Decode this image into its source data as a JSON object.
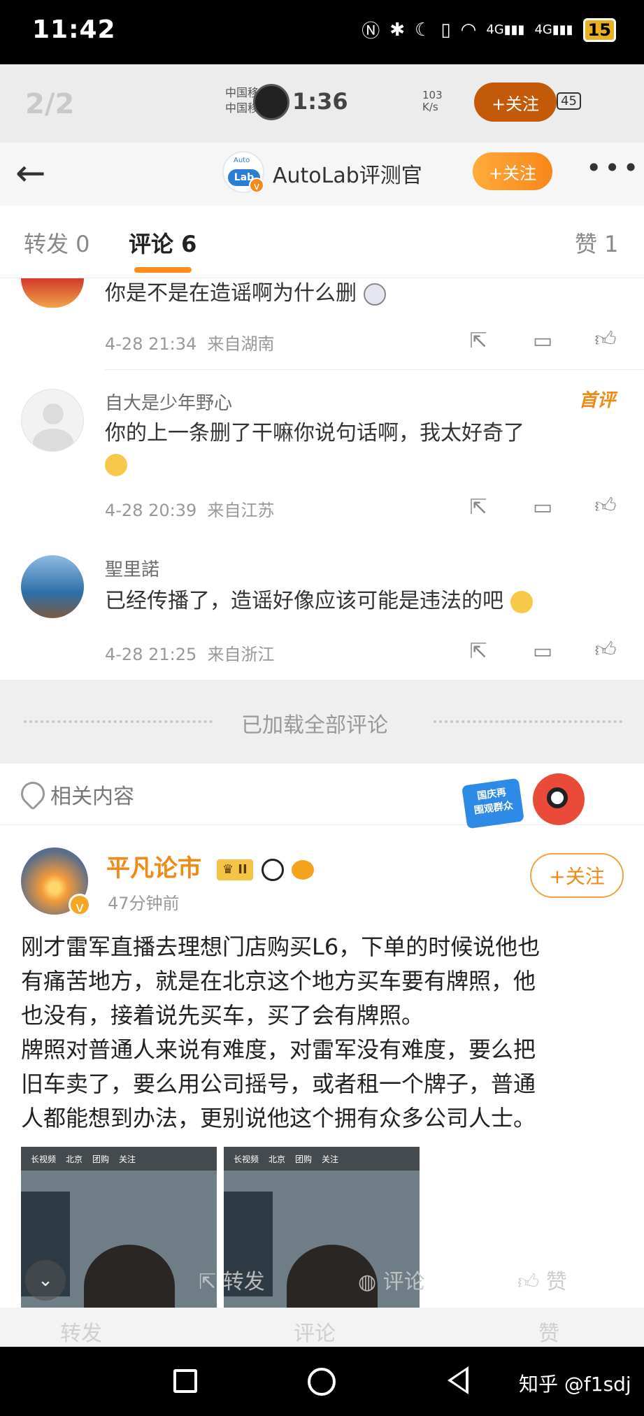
{
  "status_bar": {
    "time": "11:42",
    "icons": [
      "nfc-icon",
      "bluetooth-icon",
      "moon-icon",
      "vibrate-icon",
      "wifi-icon",
      "signal-4g-icon",
      "signal-4g-icon"
    ],
    "battery": "15"
  },
  "inner_screenshot": {
    "counter": "2/2",
    "carrier_line1": "中国移",
    "carrier_line2": "中国移",
    "time": "1:36",
    "speed_value": "103",
    "speed_unit": "K/s",
    "follow_label": "+关注",
    "battery": "45"
  },
  "header": {
    "back_icon": "arrow-left-icon",
    "account_name": "AutoLab评测官",
    "logo_text_top": "Auto",
    "logo_text_bottom": "Lab",
    "follow_label": "+关注",
    "more_icon": "more-dots-icon",
    "accent_color": "#f7871a"
  },
  "tabs": [
    {
      "label": "转发 0"
    },
    {
      "label": "评论 6"
    },
    {
      "label": "赞 1"
    }
  ],
  "comments": [
    {
      "name": "",
      "text": "你是不是在造谣啊为什么删",
      "time": "4-28 21:34",
      "location": "来自湖南"
    },
    {
      "name": "自大是少年野心",
      "badge": "首评",
      "text": "你的上一条删了干嘛你说句话啊，我太好奇了",
      "time": "4-28 20:39",
      "location": "来自江苏"
    },
    {
      "name": "聖里諾",
      "text": "已经传播了，造谣好像应该可能是违法的吧",
      "time": "4-28 21:25",
      "location": "来自浙江"
    }
  ],
  "loaded_all": "已加载全部评论",
  "related": {
    "label": "相关内容",
    "badge_line1": "国庆再",
    "badge_line2": "围观群众"
  },
  "post": {
    "author": "平凡论市",
    "level": "II",
    "time": "47分钟前",
    "follow_label": "+关注",
    "body_lines": [
      "刚才雷军直播去理想门店购买L6，下单的时候说他也",
      "有痛苦地方，就是在北京这个地方买车要有牌照，他",
      "也没有，接着说先买车，买了会有牌照。",
      "牌照对普通人来说有难度，对雷军没有难度，要么把",
      "旧车卖了，要么用公司摇号，或者租一个牌子，普通",
      "人都能想到办法，更别说他这个拥有众多公司人士。"
    ],
    "thumb_tabs": [
      "长视频",
      "北京",
      "团购",
      "关注"
    ]
  },
  "bottom_actions": {
    "repost": "转发",
    "comment": "评论",
    "like": "赞"
  },
  "ghost_bar": {
    "repost": "转发",
    "comment": "评论",
    "like": "赞"
  },
  "nav_bar": {
    "watermark": "知乎 @f1sdj"
  }
}
